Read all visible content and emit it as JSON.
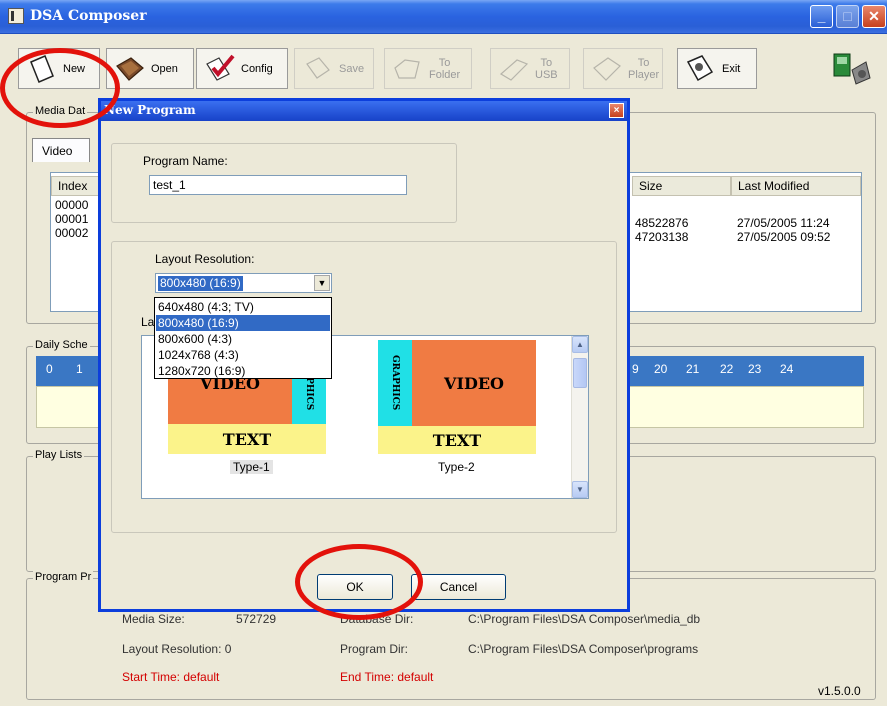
{
  "window": {
    "title": "DSA Composer"
  },
  "toolbar": {
    "new": "New",
    "open": "Open",
    "config": "Config",
    "save": "Save",
    "to_folder": [
      "To",
      "Folder"
    ],
    "to_usb": [
      "To",
      "USB"
    ],
    "to_player": [
      "To",
      "Player"
    ],
    "exit": "Exit"
  },
  "media_database": {
    "label": "Media Dat",
    "tab": "Video",
    "columns": {
      "index": "Index",
      "size": "Size",
      "last_modified": "Last Modified"
    },
    "rows": [
      {
        "index": "00000",
        "size": "",
        "last_modified": ""
      },
      {
        "index": "00001",
        "size": "48522876",
        "last_modified": "27/05/2005 11:24"
      },
      {
        "index": "00002",
        "size": "47203138",
        "last_modified": "27/05/2005 09:52"
      }
    ]
  },
  "daily_schedule": {
    "label": "Daily Sche",
    "hours_left": [
      "0",
      "1"
    ],
    "hours_right": [
      "9",
      "20",
      "21",
      "22",
      "23",
      "24"
    ]
  },
  "play_lists": {
    "label": "Play Lists"
  },
  "program_properties": {
    "label": "Program Pr",
    "media_size_label": "Media Size:",
    "media_size_value": "572729",
    "database_dir_label": "Database Dir:",
    "database_dir_value": "C:\\Program Files\\DSA Composer\\media_db",
    "layout_resolution_label": "Layout Resolution: 0",
    "program_dir_label": "Program Dir:",
    "program_dir_value": "C:\\Program Files\\DSA Composer\\programs",
    "start_time": "Start Time:  default",
    "end_time": "End Time:  default",
    "version": "v1.5.0.0"
  },
  "dialog": {
    "title": "New Program",
    "close": "×",
    "program_name_label": "Program Name:",
    "program_name_value": "test_1",
    "layout_resolution_label": "Layout Resolution:",
    "selected_resolution": "800x480 (16:9)",
    "resolution_options": [
      "640x480 (4:3; TV)",
      "800x480 (16:9)",
      "800x600 (4:3)",
      "1024x768 (4:3)",
      "1280x720 (16:9)"
    ],
    "selected_index": 1,
    "layout_type_label_visible": "La",
    "layouts": [
      {
        "video": "VIDEO",
        "graphics": "GRAPHICS",
        "text": "TEXT",
        "caption": "Type-1"
      },
      {
        "video": "VIDEO",
        "graphics": "GRAPHICS",
        "text": "TEXT",
        "caption": "Type-2"
      }
    ],
    "ok": "OK",
    "cancel": "Cancel"
  },
  "colors": {
    "annotation_ring": "#e3120b",
    "video_block": "#f07b43",
    "graphics_block": "#20e0e6",
    "text_block": "#fbf38a",
    "selection": "#316ac5"
  }
}
